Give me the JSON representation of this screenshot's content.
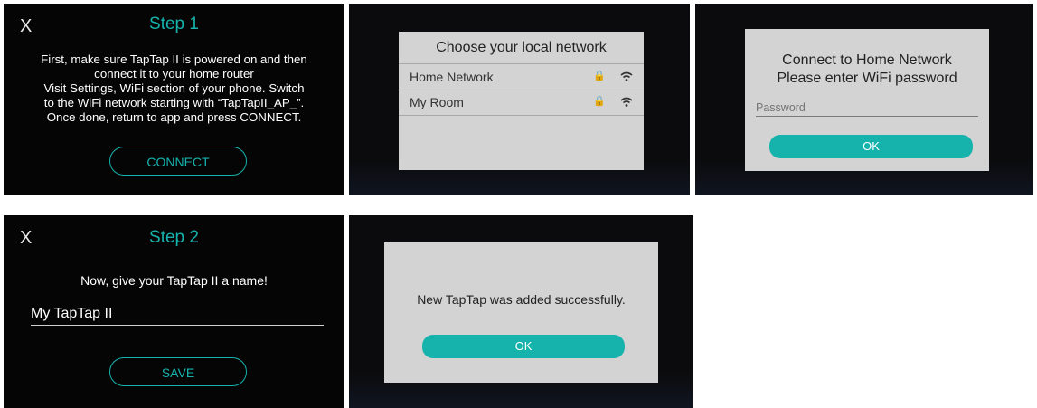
{
  "step1": {
    "close": "X",
    "title": "Step 1",
    "lines": [
      "First, make sure TapTap II is powered on and then",
      "connect it to your home router",
      "Visit Settings, WiFi section of your phone. Switch",
      "to the WiFi network starting with “TapTapII_AP_”.",
      "Once done, return to app and press CONNECT."
    ],
    "connect_label": "CONNECT"
  },
  "network_chooser": {
    "title": "Choose your local network",
    "networks": [
      {
        "name": "Home Network",
        "lock": "lock-icon",
        "signal": "wifi-icon"
      },
      {
        "name": "My Room",
        "lock": "lock-icon",
        "signal": "wifi-icon"
      }
    ]
  },
  "password_dialog": {
    "title_line1": "Connect to Home Network",
    "title_line2": "Please enter WiFi password",
    "password_placeholder": "Password",
    "ok_label": "OK"
  },
  "step2": {
    "close": "X",
    "title": "Step 2",
    "prompt": "Now, give your TapTap II a name!",
    "name_value": "My TapTap II",
    "save_label": "SAVE"
  },
  "success_dialog": {
    "message": "New TapTap was added successfully.",
    "ok_label": "OK"
  },
  "colors": {
    "accent": "#16b3ad",
    "dialog_bg": "#d3d3d3",
    "panel_bg": "#050505"
  }
}
